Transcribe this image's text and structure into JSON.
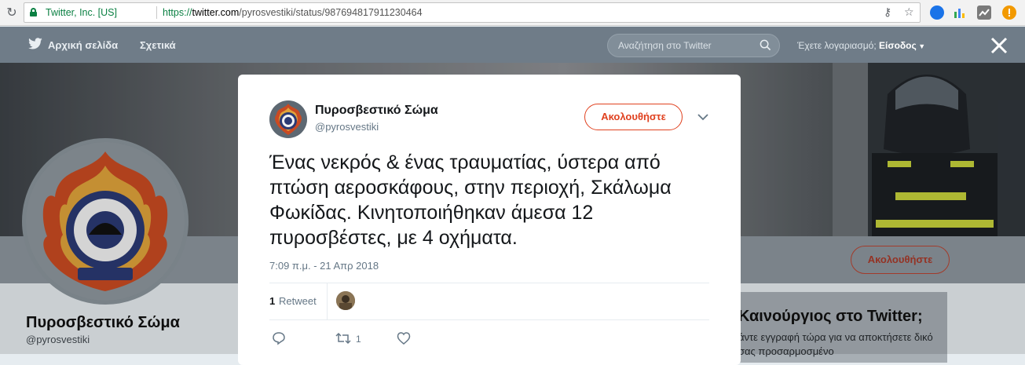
{
  "browser": {
    "cert_label": "Twitter, Inc. [US]",
    "url_scheme": "https://",
    "url_host": "twitter.com",
    "url_path": "/pyrosvestiki/status/987694817911230464"
  },
  "nav": {
    "home": "Αρχική σελίδα",
    "about": "Σχετικά",
    "search_placeholder": "Αναζήτηση στο Twitter",
    "account_prompt": "Έχετε λογαριασμό; ",
    "login": "Είσοδος"
  },
  "profile": {
    "name": "Πυροσβεστικό Σώμα",
    "handle": "@pyrosvestiki",
    "follow_label": "Ακολουθήστε"
  },
  "signup_card": {
    "heading": "Καινούργιος στο Twitter;",
    "text": "άντε εγγραφή τώρα για να αποκτήσετε δικό σας προσαρμοσμένο"
  },
  "tweet": {
    "author_name": "Πυροσβεστικό Σώμα",
    "author_handle": "@pyrosvestiki",
    "follow_label": "Ακολουθήστε",
    "text": "Ένας νεκρός & ένας τραυματίας, ύστερα από πτώση αεροσκάφους, στην περιοχή, Σκάλωμα Φωκίδας. Κινητοποιήθηκαν άμεσα 12 πυροσβέστες, με 4 οχήματα.",
    "timestamp": "7:09 π.μ. - 21 Απρ 2018",
    "retweet_count": "1",
    "retweet_label": "Retweet",
    "retweet_action_count": "1"
  },
  "colors": {
    "follow_accent": "#e0411f",
    "twitter_blue": "#1da1f2",
    "secure_green": "#0b8043"
  }
}
